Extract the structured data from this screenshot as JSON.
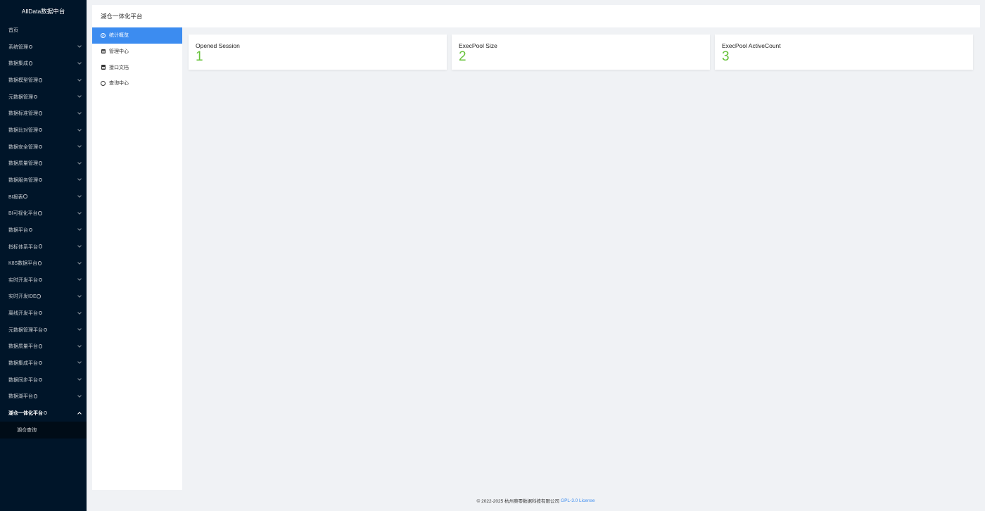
{
  "app": {
    "logo_text": "AllData数据中台"
  },
  "sidebar": {
    "home": "首页",
    "items": [
      "系统管理",
      "数据集成",
      "数据模型管理",
      "元数据管理",
      "数据标准管理",
      "数据比对管理",
      "数据安全管理",
      "数据质量管理",
      "数据服务管理",
      "BI报表",
      "BI可视化平台",
      "数据平台",
      "指标体系平台",
      "K8S数据平台",
      "实时开发平台",
      "实时开发IDE",
      "离线开发平台",
      "元数据管理平台",
      "数据质量平台",
      "数据集成平台",
      "数据同步平台",
      "数据湖平台"
    ],
    "open_item": "湖仓一体化平台",
    "open_sub_items": [
      "湖仓查询"
    ]
  },
  "header": {
    "title": "湖仓一体化平台"
  },
  "submenu": {
    "items": [
      {
        "label": "统计概览",
        "icon": "dashboard-icon",
        "active": true
      },
      {
        "label": "管理中心",
        "icon": "calendar-icon",
        "active": false
      },
      {
        "label": "接口文档",
        "icon": "calendar-icon",
        "active": false
      },
      {
        "label": "查询中心",
        "icon": "circle-icon",
        "active": false
      }
    ]
  },
  "stats": {
    "cards": [
      {
        "title": "Opened Session",
        "value": "1"
      },
      {
        "title": "ExecPool Size",
        "value": "2"
      },
      {
        "title": "ExecPool ActiveCount",
        "value": "3"
      }
    ]
  },
  "footer": {
    "copyright": "© 2022-2025 杭州奥零数据科技有限公司",
    "license_link": "GPL-3.0 License"
  },
  "colors": {
    "sidebar_bg": "#001529",
    "accent": "#3c8cf0",
    "stat_value": "#67c23a"
  }
}
